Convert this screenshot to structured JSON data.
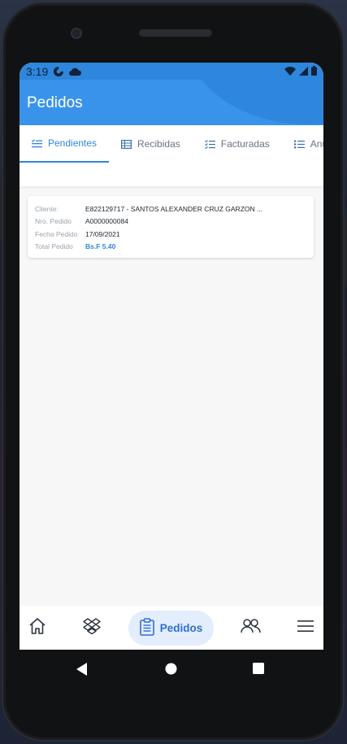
{
  "status_bar": {
    "time": "3:19",
    "icons_left": [
      "data-saver-icon",
      "cloud-icon"
    ],
    "icons_right": [
      "wifi-icon",
      "signal-icon",
      "battery-icon"
    ]
  },
  "app_bar": {
    "title": "Pedidos"
  },
  "tabs": [
    {
      "label": "Pendientes",
      "icon": "list-check-icon",
      "active": true
    },
    {
      "label": "Recibidas",
      "icon": "table-icon",
      "active": false
    },
    {
      "label": "Facturadas",
      "icon": "checklist-icon",
      "active": false
    },
    {
      "label": "Anuladas",
      "icon": "list-icon",
      "active": false
    }
  ],
  "order_card": {
    "cliente_label": "Cliente:",
    "cliente_value": "E822129717 - SANTOS ALEXANDER CRUZ GARZON ...",
    "nro_label": "Nro. Pedido",
    "nro_value": "A0000000084",
    "fecha_label": "Fecha Pedido",
    "fecha_value": "17/09/2021",
    "total_label": "Total Pedido",
    "total_value": "Bs.F 5.40"
  },
  "bottom_nav": {
    "items": [
      "home-icon",
      "dropbox-icon",
      "clipboard-icon",
      "users-icon",
      "menu-icon"
    ],
    "active_label": "Pedidos"
  },
  "colors": {
    "primary": "#3a93ea",
    "primary_dark": "#2f86dd",
    "active_pill": "#e3edfb",
    "total_value": "#2f86dd"
  }
}
